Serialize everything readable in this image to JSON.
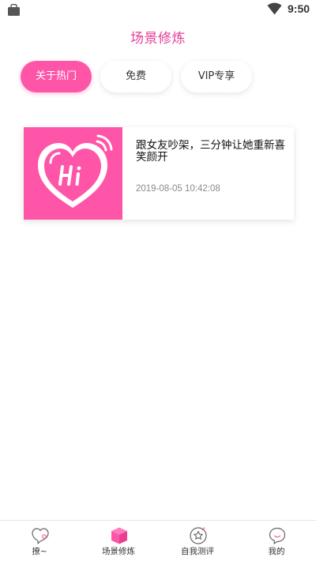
{
  "status_bar": {
    "time": "9:50"
  },
  "header": {
    "title": "场景修炼"
  },
  "tabs": [
    {
      "label": "关于热门",
      "active": true
    },
    {
      "label": "免费",
      "active": false
    },
    {
      "label": "VIP专享",
      "active": false
    }
  ],
  "articles": [
    {
      "title": "跟女友吵架，三分钟让她重新喜笑颜开",
      "date": "2019-08-05 10:42:08",
      "thumbnail_icon": "hi-heart-icon"
    }
  ],
  "bottom_nav": [
    {
      "label": "撩~",
      "icon": "heart-chat-icon",
      "active": false
    },
    {
      "label": "场景修炼",
      "icon": "cube-icon",
      "active": true
    },
    {
      "label": "自我测评",
      "icon": "star-circle-icon",
      "active": false
    },
    {
      "label": "我的",
      "icon": "profile-chat-icon",
      "active": false
    }
  ],
  "colors": {
    "accent": "#ff55a8",
    "title": "#e33f95",
    "date": "#8a8a8a"
  }
}
